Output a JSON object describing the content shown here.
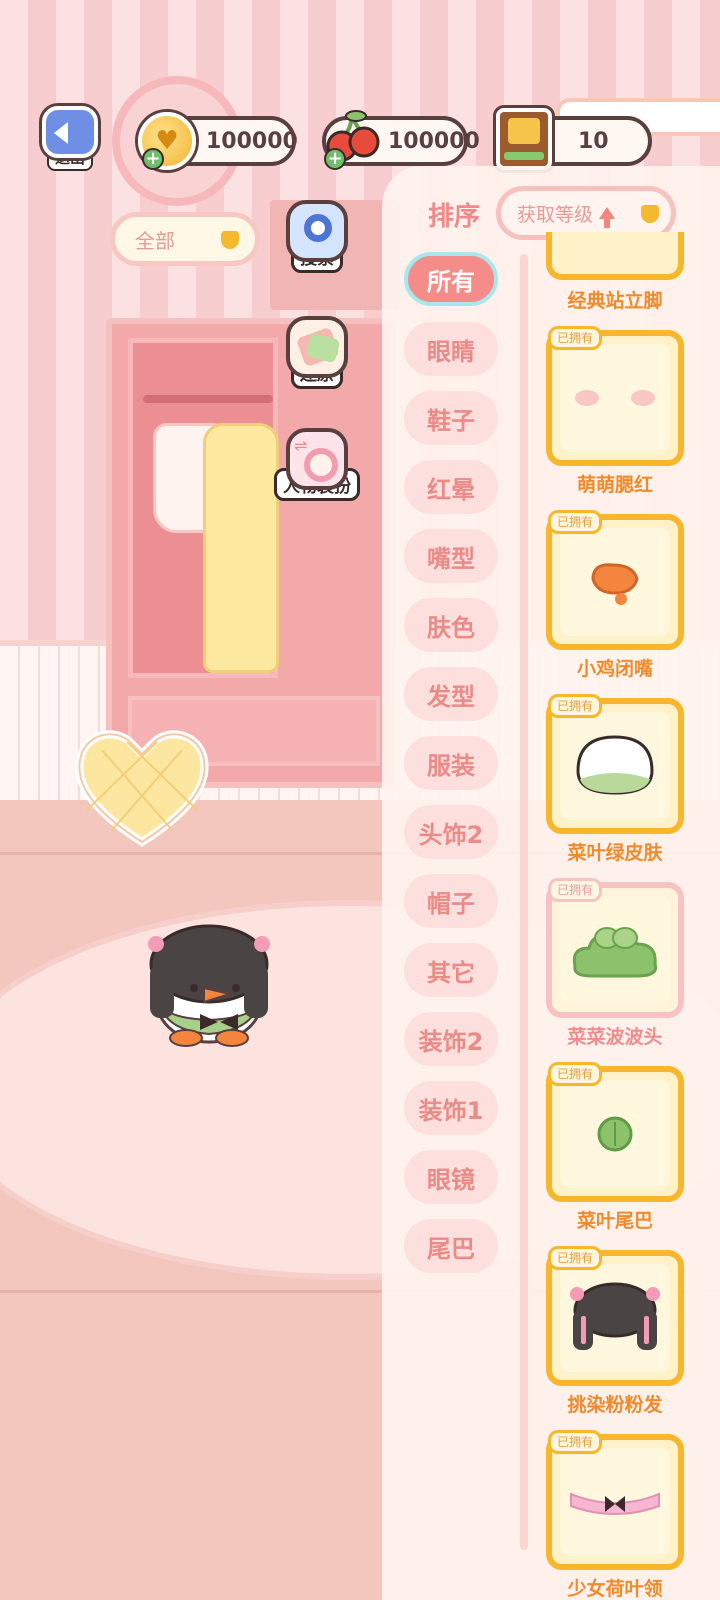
{
  "hud": {
    "exit_label": "退出",
    "coins": "100000",
    "cherries": "100000",
    "books": "10"
  },
  "filter": {
    "label": "全部"
  },
  "tools": [
    {
      "label": "搜索",
      "icon": "search-icon"
    },
    {
      "label": "还原",
      "icon": "restore-clothes-icon"
    },
    {
      "label": "人物装扮",
      "icon": "character-dressup-icon"
    }
  ],
  "panel": {
    "sort_label": "排序",
    "sort_value": "获取等级",
    "categories": [
      "所有",
      "眼睛",
      "鞋子",
      "红晕",
      "嘴型",
      "肤色",
      "发型",
      "服装",
      "头饰2",
      "帽子",
      "其它",
      "装饰2",
      "装饰1",
      "眼镜",
      "尾巴"
    ],
    "active_category": "所有",
    "owned_tag": "已拥有",
    "items": [
      {
        "name": "经典站立脚"
      },
      {
        "name": "萌萌腮红"
      },
      {
        "name": "小鸡闭嘴"
      },
      {
        "name": "菜叶绿皮肤"
      },
      {
        "name": "菜菜波波头"
      },
      {
        "name": "菜叶尾巴"
      },
      {
        "name": "挑染粉粉发"
      },
      {
        "name": "少女荷叶领"
      }
    ]
  },
  "colors": {
    "accent_pink": "#f48d8a",
    "gold_border": "#f8b72a",
    "item_name_orange": "#f08b2c"
  }
}
